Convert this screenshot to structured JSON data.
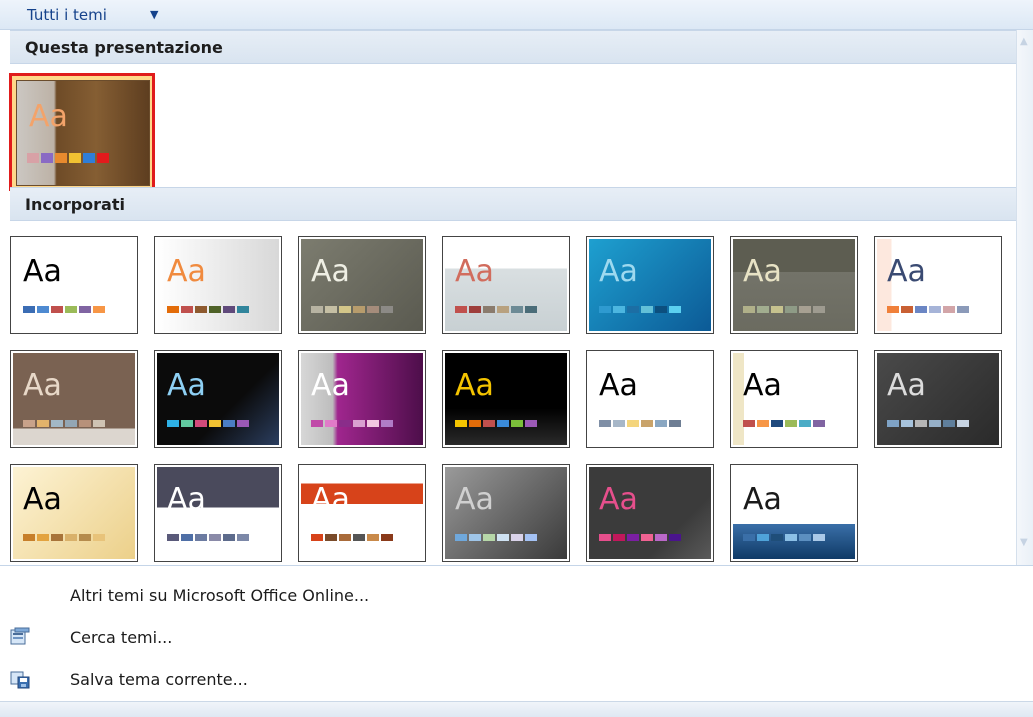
{
  "header": {
    "title": "Tutti i temi",
    "caret": "▼"
  },
  "sections": {
    "current": "Questa presentazione",
    "builtin": "Incorporati"
  },
  "current_theme": {
    "aa": "Aa",
    "swatches": [
      "#d8a1a6",
      "#8a6ac4",
      "#e88a2e",
      "#f1c232",
      "#2f7ed8",
      "#e31a1c"
    ]
  },
  "themes": [
    {
      "aa": "Aa",
      "bg": "#ffffff",
      "fg": "#000000",
      "sw": [
        "#3b6db4",
        "#4e8ad1",
        "#c0504d",
        "#9bbb59",
        "#8064a2",
        "#f79646"
      ]
    },
    {
      "aa": "Aa",
      "bg": "linear-gradient(90deg,#ffffff,#d8d8d8)",
      "fg": "#f08a3e",
      "sw": [
        "#e36c09",
        "#c0504d",
        "#8e5a2f",
        "#4f6228",
        "#604a7b",
        "#31859c"
      ]
    },
    {
      "aa": "Aa",
      "bg": "linear-gradient(135deg,#7c7c6f,#5a5a50)",
      "fg": "#efefe4",
      "sw": [
        "#b7b3a2",
        "#c5bfa4",
        "#d3c689",
        "#b79c6c",
        "#a58c7b",
        "#8c8a86"
      ]
    },
    {
      "aa": "Aa",
      "bg": "linear-gradient(#ffffff 0%,#ffffff 32%,#d9dfe1 32%,#c8d0d3 100%)",
      "fg": "#d16c5d",
      "sw": [
        "#c0504d",
        "#9e3e3c",
        "#8a7b6d",
        "#b8a17f",
        "#6c8a95",
        "#4a6c78"
      ]
    },
    {
      "aa": "Aa",
      "bg": "linear-gradient(135deg,#1ea0d0,#0c5a96)",
      "fg": "#9ed9ef",
      "sw": [
        "#2e9ad0",
        "#4cb6e0",
        "#1c6ea4",
        "#63c0d8",
        "#0c4f7e",
        "#5bd0f0"
      ]
    },
    {
      "aa": "Aa",
      "bg": "linear-gradient(#5d5d51 0%,#5d5d51 36%,#737369 36%,#6b6b60 100%)",
      "fg": "#e8e3c5",
      "sw": [
        "#b0b089",
        "#a1ad8f",
        "#c6c28e",
        "#8e9b86",
        "#a7a092",
        "#9e9b90"
      ]
    },
    {
      "aa": "Aa",
      "bg": "linear-gradient(90deg,#fde8de 0%,#fde8de 12%,#ffffff 12%,#ffffff 100%)",
      "fg": "#3a4a72",
      "sw": [
        "#f0803a",
        "#c96033",
        "#6b86c4",
        "#a6b4d8",
        "#d2a5a8",
        "#8b9ab9"
      ]
    },
    {
      "aa": "Aa",
      "bg": "linear-gradient(#7a6252 0%,#7a6252 82%,#dcd6cf 82%)",
      "fg": "#e8d8c8",
      "sw": [
        "#c8a28a",
        "#e3b36b",
        "#a3b8c6",
        "#93a6b4",
        "#b7917a",
        "#cfc3b3"
      ]
    },
    {
      "aa": "Aa",
      "bg": "linear-gradient(135deg,#0b0b0b 60%,#2b3e60 100%)",
      "fg": "#8ed0f4",
      "sw": [
        "#2eb1e6",
        "#62c9a0",
        "#d24a7a",
        "#f1c232",
        "#4a7dc4",
        "#9b59b6"
      ]
    },
    {
      "aa": "Aa",
      "bg": "linear-gradient(90deg,#d7d7d7 0%,#bdbdbd 26%,#a0268e 30%,#4d0e4a 100%)",
      "fg": "#ffffff",
      "sw": [
        "#c04aa8",
        "#e07bc8",
        "#8a2d8a",
        "#d9a0d0",
        "#f2c6e0",
        "#b07cc6"
      ]
    },
    {
      "aa": "Aa",
      "bg": "linear-gradient(#000000 60%,#2a2a2a 100%)",
      "fg": "#f4c400",
      "sw": [
        "#f4c400",
        "#e36c09",
        "#c0504d",
        "#3a8ad8",
        "#7bbf3a",
        "#9b59b6"
      ]
    },
    {
      "aa": "Aa",
      "bg": "#ffffff",
      "fg": "#000000",
      "sw": [
        "#7f8fa6",
        "#a7b7c8",
        "#f4d57c",
        "#c9a36a",
        "#8aa7c2",
        "#6e7e94"
      ]
    },
    {
      "aa": "Aa",
      "bg": "linear-gradient(90deg,#efe6c6 0%,#efe6c6 9%,#ffffff 9%)",
      "fg": "#000000",
      "sw": [
        "#c0504d",
        "#f79646",
        "#1f497d",
        "#9bbb59",
        "#4bacc6",
        "#8064a2"
      ]
    },
    {
      "aa": "Aa",
      "bg": "linear-gradient(135deg,#4a4a4a,#2a2a2a)",
      "fg": "#dcdcdc",
      "sw": [
        "#7fa3c6",
        "#a7c3dc",
        "#b6b6b6",
        "#96b0c8",
        "#5f7f9c",
        "#c7d4e2"
      ]
    },
    {
      "aa": "Aa",
      "bg": "linear-gradient(135deg,#fdf3d4,#ecd08a)",
      "fg": "#000000",
      "sw": [
        "#c77f2a",
        "#e3a33f",
        "#a8743a",
        "#d9b16a",
        "#b58b4c",
        "#e8c37a"
      ]
    },
    {
      "aa": "Aa",
      "bg": "linear-gradient(#4a4a5c 0%,#4a4a5c 44%,#ffffff 44%)",
      "fg": "#ffffff",
      "sw": [
        "#5a5a7a",
        "#4f6fa6",
        "#6c7ba1",
        "#8a8aa8",
        "#5d6b8c",
        "#7c88a8"
      ]
    },
    {
      "aa": "Aa",
      "bg": "linear-gradient(#ffffff 0%,#ffffff 18%,#d7431a 18%,#d7431a 40%,#ffffff 40%)",
      "fg": "#ffffff",
      "sw": [
        "#d7431a",
        "#7a4b2a",
        "#a96b3a",
        "#555555",
        "#c98a4a",
        "#8a3a1a"
      ]
    },
    {
      "aa": "Aa",
      "bg": "linear-gradient(135deg,#9a9a9a,#3a3a3a)",
      "fg": "#d0d0d0",
      "sw": [
        "#6fa8dc",
        "#9fc5e8",
        "#b6d7a8",
        "#cfe2f3",
        "#d9d2e9",
        "#a4c2f4"
      ]
    },
    {
      "aa": "Aa",
      "bg": "linear-gradient(135deg,#3b3b3b 70%,#5a5a5a 100%)",
      "fg": "#e64f8c",
      "sw": [
        "#e64f8c",
        "#c2185b",
        "#7b1fa2",
        "#f06292",
        "#ba68c8",
        "#4a148c"
      ]
    },
    {
      "aa": "Aa",
      "bg": "linear-gradient(#ffffff 0%,#ffffff 62%,#3a6fa8 62%,#0f3a66 100%)",
      "fg": "#1a1a1a",
      "sw": [
        "#3a6fa8",
        "#4fa3d9",
        "#1f4e79",
        "#8cc0e6",
        "#5c8fc0",
        "#aac9e8"
      ]
    }
  ],
  "menu": {
    "online": "Altri temi su Microsoft Office Online...",
    "search": "Cerca temi...",
    "save": "Salva tema corrente..."
  }
}
